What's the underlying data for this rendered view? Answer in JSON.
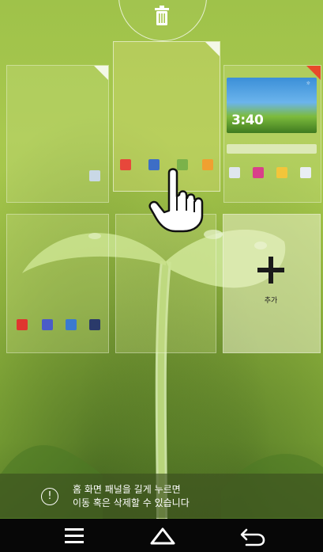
{
  "trash": {
    "icon": "trash-icon"
  },
  "panels": {
    "add_panel": {
      "label": "추가",
      "icon": "plus-icon"
    },
    "clock_widget": {
      "time": "3:40",
      "small": "☼"
    }
  },
  "hint": {
    "line1": "홈 화면 패널을 길게 누르면",
    "line2": "이동 혹은 삭제할 수 있습니다",
    "icon": "info-icon"
  },
  "navbar": {
    "menu": "menu-icon",
    "home": "home-icon",
    "back": "back-icon"
  },
  "colors": {
    "accent": "#e84a2a",
    "nav_bg": "#070707"
  }
}
